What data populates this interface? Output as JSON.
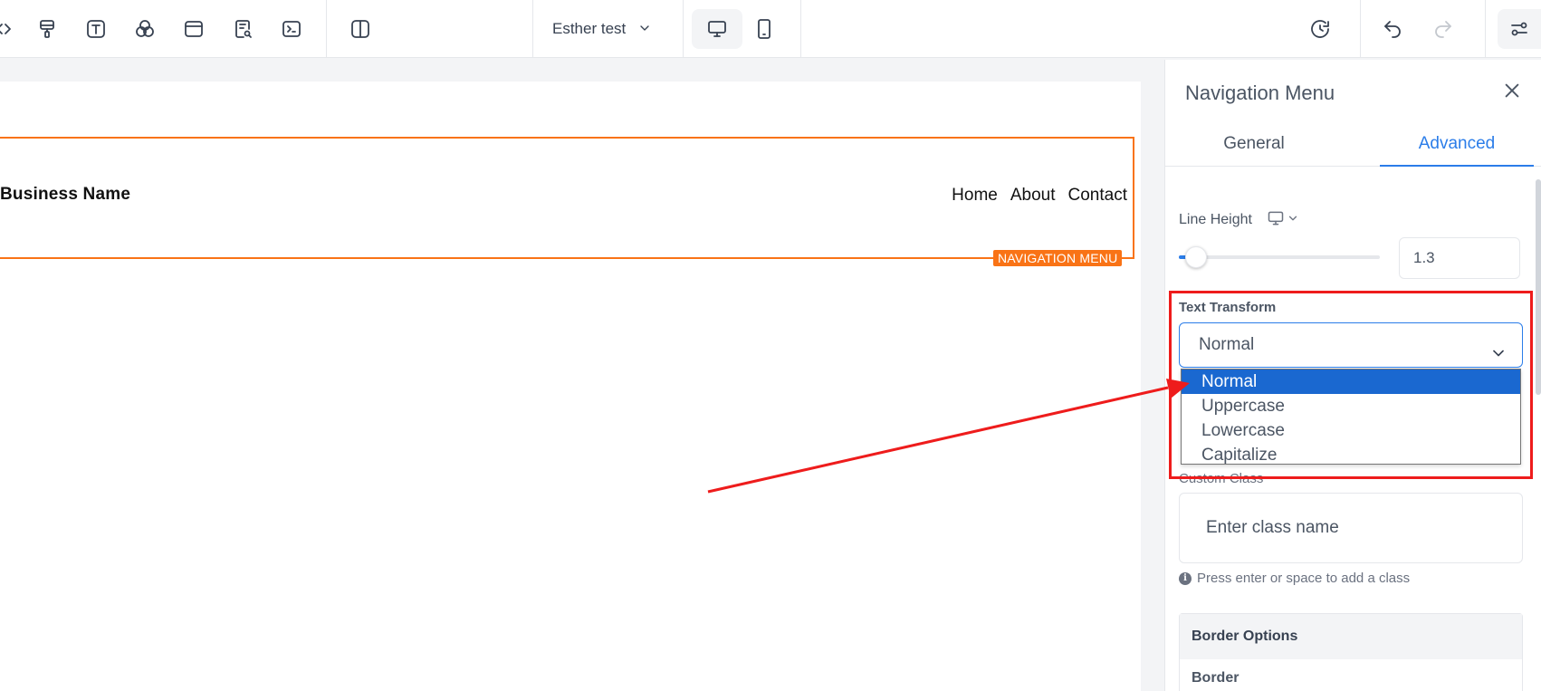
{
  "toolbar": {
    "site_name": "Esther test",
    "icons": [
      "code-icon",
      "paint-roller-icon",
      "text-icon",
      "shapes-icon",
      "layout-icon",
      "page-search-icon",
      "terminal-icon",
      "split-view-icon",
      "desktop-icon",
      "mobile-icon",
      "history-icon",
      "undo-icon",
      "redo-icon",
      "settings-sliders-icon"
    ]
  },
  "canvas": {
    "business_name": "Business Name",
    "nav_links": [
      "Home",
      "About",
      "Contact"
    ],
    "element_tag": "NAVIGATION MENU"
  },
  "panel": {
    "title": "Navigation Menu",
    "tabs": [
      "General",
      "Advanced"
    ],
    "active_tab": "Advanced",
    "line_height": {
      "label": "Line Height",
      "value": "1.3"
    },
    "text_transform": {
      "label": "Text Transform",
      "selected": "Normal",
      "options": [
        "Normal",
        "Uppercase",
        "Lowercase",
        "Capitalize"
      ]
    },
    "custom_class": {
      "label": "Custom Class",
      "placeholder": "Enter class name",
      "hint": "Press enter or space to add a class"
    },
    "border_options": {
      "title": "Border Options",
      "border_label": "Border"
    }
  },
  "colors": {
    "accent": "#2b7de9",
    "selection": "#1a68d0",
    "element_outline": "#f97316",
    "annotation": "#ee1c1c"
  }
}
